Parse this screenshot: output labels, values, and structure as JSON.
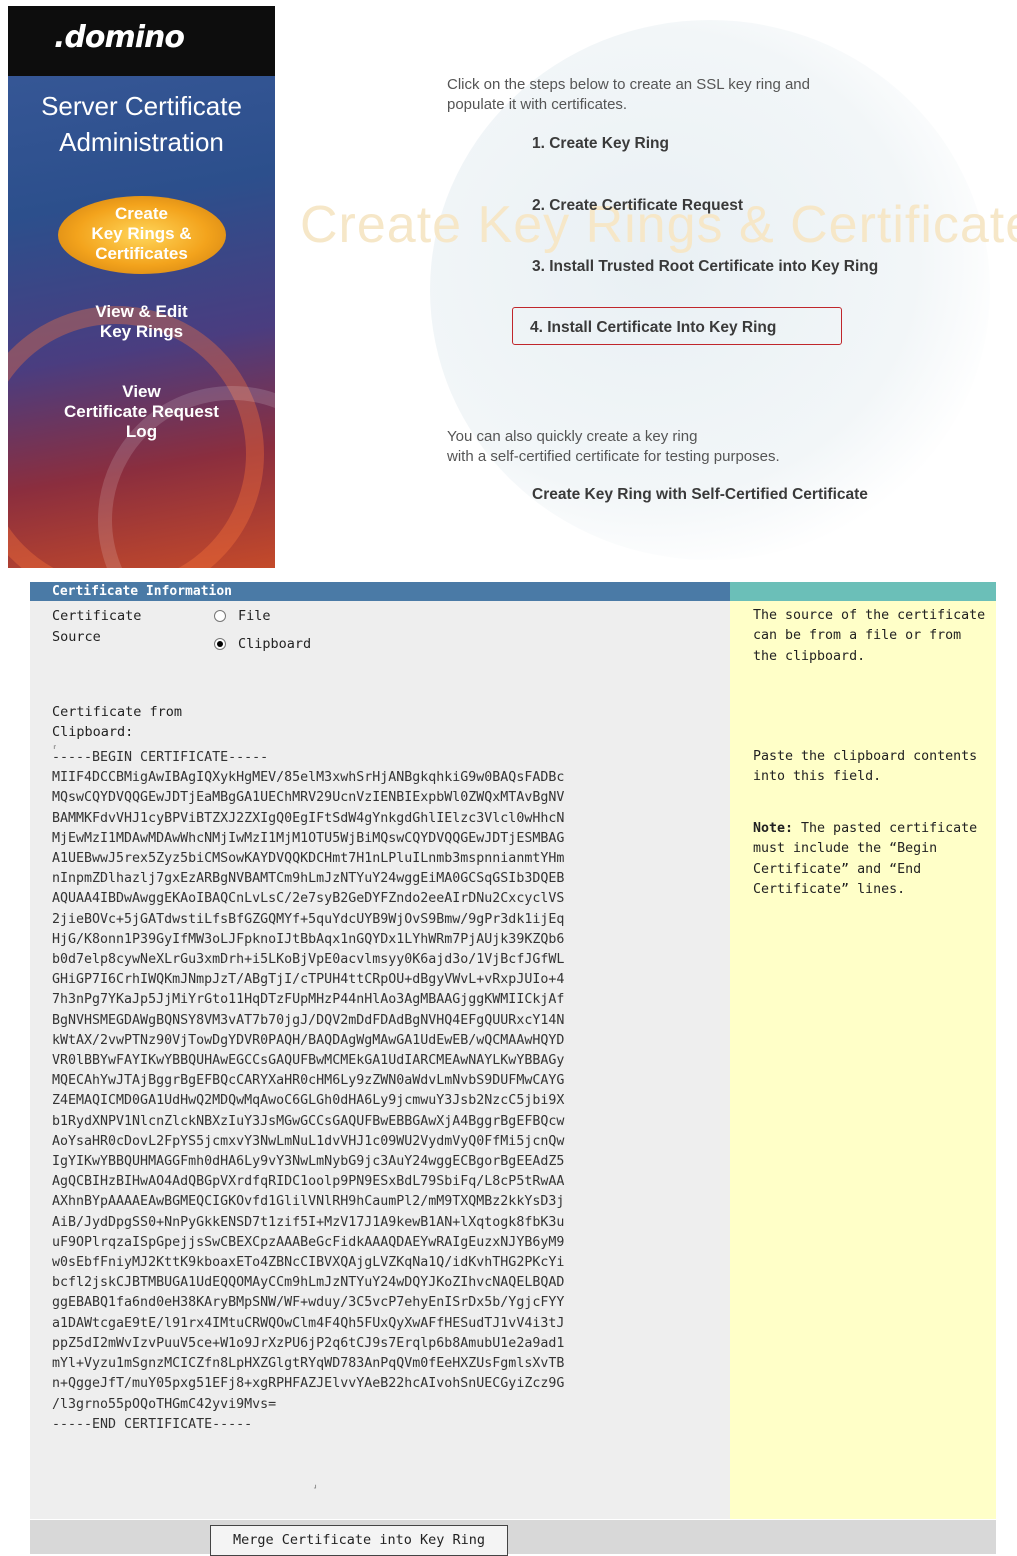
{
  "sidebar": {
    "logo": ".domino",
    "title_line1": "Server Certificate",
    "title_line2": "Administration",
    "nav": {
      "create": [
        "Create",
        "Key Rings &",
        "Certificates"
      ],
      "view_edit": [
        "View & Edit",
        "Key Rings"
      ],
      "view_log": [
        "View",
        "Certificate Request",
        "Log"
      ]
    }
  },
  "main": {
    "intro_line1": "Click on the steps below to create an SSL key ring and",
    "intro_line2": "populate it with certificates.",
    "watermark": "Create Key Rings & Certificates",
    "steps": [
      "1. Create Key Ring",
      "2. Create Certificate Request",
      "3. Install Trusted Root Certificate into Key Ring",
      "4. Install Certificate Into Key Ring"
    ],
    "also_line1": "You can also quickly create a key ring",
    "also_line2": "with a self-certified certificate for testing purposes.",
    "self_cert_link": "Create Key Ring  with Self-Certified Certificate"
  },
  "form": {
    "header": "Certificate Information",
    "source_label_1": "Certificate",
    "source_label_2": "Source",
    "option_file": "File",
    "option_clipboard": "Clipboard",
    "selected_option": "Clipboard",
    "clip_label_1": "Certificate from",
    "clip_label_2": "Clipboard:",
    "certificate_lines": [
      "-----BEGIN CERTIFICATE-----",
      "MIIF4DCCBMigAwIBAgIQXykHgMEV/85elM3xwhSrHjANBgkqhkiG9w0BAQsFADBc",
      "MQswCQYDVQQGEwJDTjEaMBgGA1UEChMRV29UcnVzIENBIExpbWl0ZWQxMTAvBgNV",
      "BAMMKFdvVHJ1cyBPViBTZXJ2ZXIgQ0EgIFtSdW4gYnkgdGhlIElzc3Vlcl0wHhcN",
      "MjEwMzI1MDAwMDAwWhcNMjIwMzI1MjM1OTU5WjBiMQswCQYDVQQGEwJDTjESMBAG",
      "A1UEBwwJ5rex5Zyz5biCMSowKAYDVQQKDCHmt7H1nLPluILnmb3mspnnianmtYHm",
      "nInpmZDlhazlj7gxEzARBgNVBAMTCm9hLmJzNTYuY24wggEiMA0GCSqGSIb3DQEB",
      "AQUAA4IBDwAwggEKAoIBAQCnLvLsC/2e7syB2GeDYFZndo2eeAIrDNu2CxcyclVS",
      "2jieBOVc+5jGATdwstiLfsBfGZGQMYf+5quYdcUYB9WjOvS9Bmw/9gPr3dk1ijEq",
      "HjG/K8onn1P39GyIfMW3oLJFpknoIJtBbAqx1nGQYDx1LYhWRm7PjAUjk39KZQb6",
      "b0d7elp8cywNeXLrGu3xmDrh+i5LKoBjVpE0acvlmsyy0K6ajd3o/1VjBcfJGfWL",
      "GHiGP7I6CrhIWQKmJNmpJzT/ABgTjI/cTPUH4ttCRpOU+dBgyVWvL+vRxpJUIo+4",
      "7h3nPg7YKaJp5JjMiYrGto11HqDTzFUpMHzP44nHlAo3AgMBAAGjggKWMIICkjAf",
      "BgNVHSMEGDAWgBQNSY8VM3vAT7b70jgJ/DQV2mDdFDAdBgNVHQ4EFgQUURxcY14N",
      "kWtAX/2vwPTNz90VjTowDgYDVR0PAQH/BAQDAgWgMAwGA1UdEwEB/wQCMAAwHQYD",
      "VR0lBBYwFAYIKwYBBQUHAwEGCCsGAQUFBwMCMEkGA1UdIARCMEAwNAYLKwYBBAGy",
      "MQECAhYwJTAjBggrBgEFBQcCARYXaHR0cHM6Ly9zZWN0aWdvLmNvbS9DUFMwCAYG",
      "Z4EMAQICMD0GA1UdHwQ2MDQwMqAwoC6GLGh0dHA6Ly9jcmwuY3Jsb2NzcC5jbi9X",
      "b1RydXNPV1NlcnZlckNBXzIuY3JsMGwGCCsGAQUFBwEBBGAwXjA4BggrBgEFBQcw",
      "AoYsaHR0cDovL2FpYS5jcmxvY3NwLmNuL1dvVHJ1c09WU2VydmVyQ0FfMi5jcnQw",
      "IgYIKwYBBQUHMAGGFmh0dHA6Ly9vY3NwLmNybG9jc3AuY24wggECBgorBgEEAdZ5",
      "AgQCBIHzBIHwAO4AdQBGpVXrdfqRIDC1oolp9PN9ESxBdL79SbiFq/L8cP5tRwAA",
      "AXhnBYpAAAAEAwBGMEQCIGKOvfd1GlilVNlRH9hCaumPl2/mM9TXQMBz2kkYsD3j",
      "AiB/JydDpgSS0+NnPyGkkENSD7t1zif5I+MzV17J1A9kewB1AN+lXqtogk8fbK3u",
      "uF9OPlrqzaISpGpejjsSwCBEXCpzAAABeGcFidkAAAQDAEYwRAIgEuzxNJYB6yM9",
      "w0sEbfFniyMJ2KttK9kboaxETo4ZBNcCIBVXQAjgLVZKqNa1Q/idKvhTHG2PKcYi",
      "bcfl2jskCJBTMBUGA1UdEQQOMAyCCm9hLmJzNTYuY24wDQYJKoZIhvcNAQELBQAD",
      "ggEBABQ1fa6nd0eH38KAryBMpSNW/WF+wduy/3C5vcP7ehyEnISrDx5b/YgjcFYY",
      "a1DAWtcgaE9tE/l91rx4IMtuCRWQOwClm4F4Qh5FUxQyXwAFfHESudTJ1vV4i3tJ",
      "ppZ5dI2mWvIzvPuuV5ce+W1o9JrXzPU6jP2q6tCJ9s7Erqlp6b8AmubU1e2a9ad1",
      "mYl+Vyzu1mSgnzMCICZfn8LpHXZGlgtRYqWD783AnPqQVm0fEeHXZUsFgmlsXvTB",
      "n+QggeJfT/muY05pxg51EFj8+xgRPHFAZJElvvYAeB22hcAIvohSnUECGyiZcz9G",
      "/l3grno55pOQoTHGmC42yvi9Mvs=",
      "-----END CERTIFICATE-----"
    ],
    "help_1": "The source of the certificate can be from a file or from the clipboard.",
    "help_2": "Paste the clipboard contents into this field.",
    "help_3_bold": "Note:",
    "help_3": " The pasted certificate must include the “Begin Certificate” and “End Certificate” lines.",
    "submit_button": "Merge Certificate into Key Ring"
  }
}
